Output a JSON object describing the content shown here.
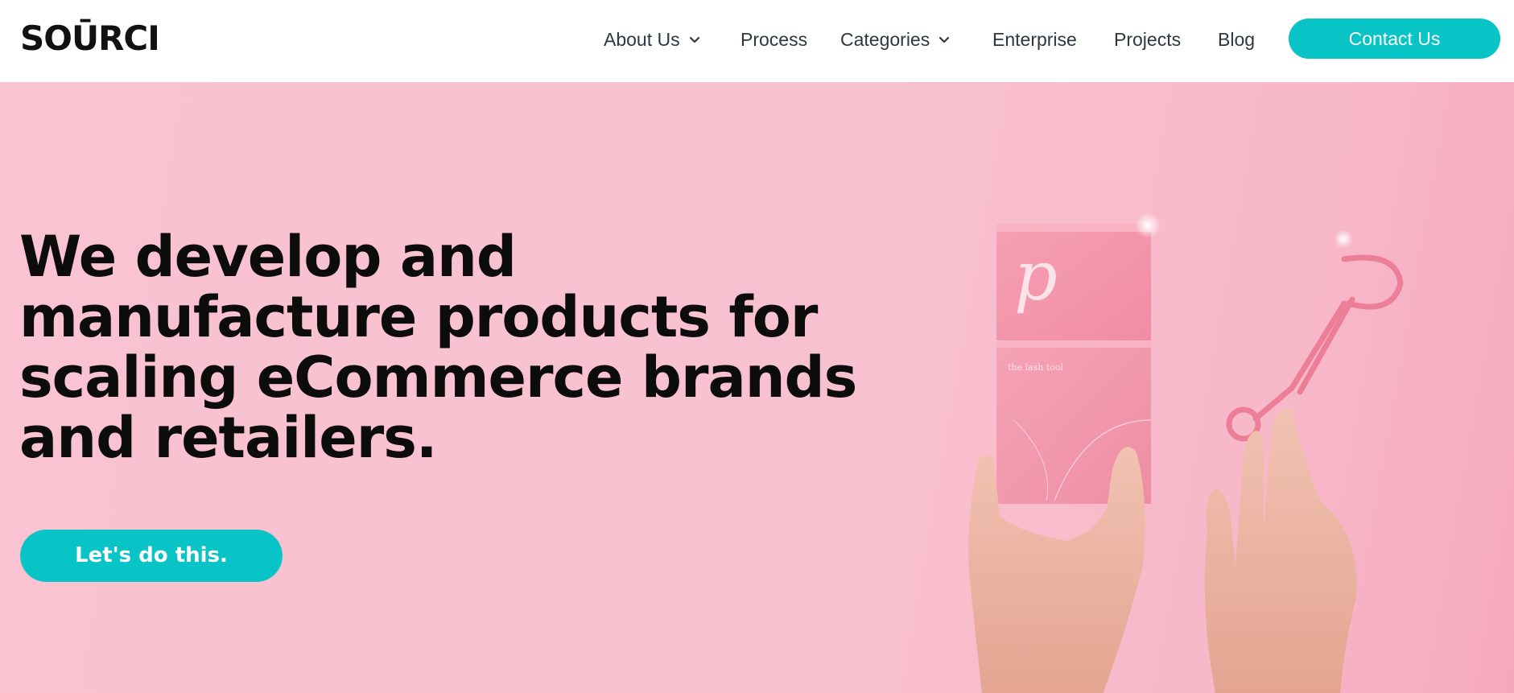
{
  "header": {
    "logo": "SOŪRCI",
    "nav": [
      {
        "label": "About Us",
        "has_dropdown": true
      },
      {
        "label": "Process",
        "has_dropdown": false
      },
      {
        "label": "Categories",
        "has_dropdown": true
      },
      {
        "label": "Enterprise",
        "has_dropdown": false
      },
      {
        "label": "Projects",
        "has_dropdown": false
      },
      {
        "label": "Blog",
        "has_dropdown": false
      }
    ],
    "contact_label": "Contact Us"
  },
  "hero": {
    "title": "We develop and manufacture products for scaling eCommerce brands and retailers.",
    "cta_label": "Let's do this.",
    "product_box_brand": "p",
    "product_box_text": "the lash tool"
  },
  "colors": {
    "accent": "#09c4c6",
    "hero_background": "#f9c3d1",
    "text_dark": "#0c0c0c",
    "nav_text": "#2f3542"
  },
  "icons": {
    "dropdown": "chevron-down-icon"
  }
}
